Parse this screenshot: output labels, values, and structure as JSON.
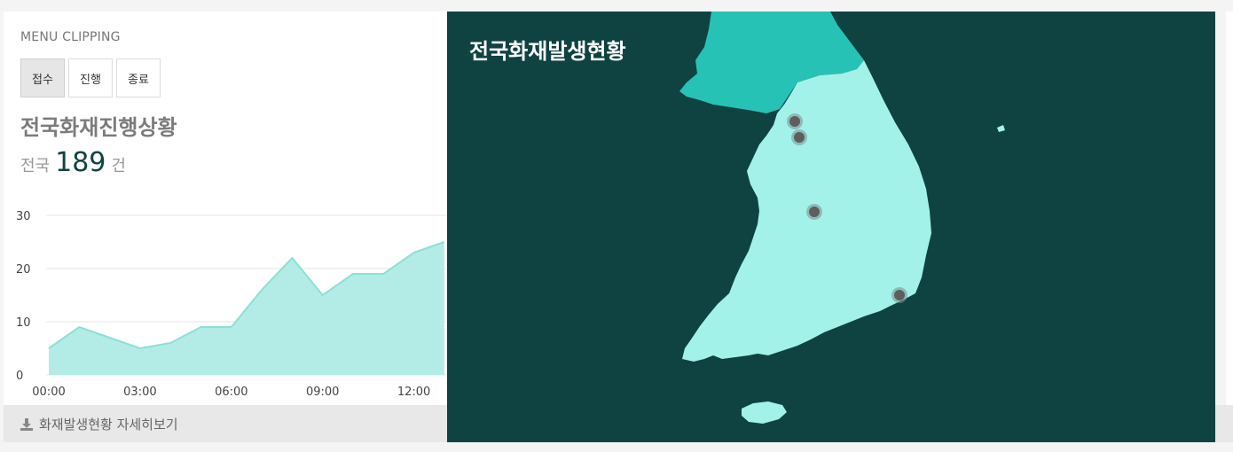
{
  "left_panel": {
    "menu_title": "MENU CLIPPING",
    "tabs": [
      {
        "label": "접수",
        "active": true
      },
      {
        "label": "진행",
        "active": false
      },
      {
        "label": "종료",
        "active": false
      }
    ],
    "status_title": "전국화재진행상황",
    "count": {
      "prefix": "전국",
      "value": "189",
      "suffix": "건"
    }
  },
  "chart_data": {
    "type": "area",
    "x": [
      "00:00",
      "01:00",
      "02:00",
      "03:00",
      "04:00",
      "05:00",
      "06:00",
      "07:00",
      "08:00",
      "09:00",
      "10:00",
      "11:00",
      "12:00",
      "13:00"
    ],
    "series": [
      {
        "values": [
          5,
          9,
          7,
          5,
          6,
          9,
          9,
          16,
          22,
          15,
          19,
          19,
          23,
          25
        ]
      }
    ],
    "x_tick_labels": [
      "00:00",
      "03:00",
      "06:00",
      "09:00",
      "12:00"
    ],
    "y_ticks": [
      0,
      10,
      20,
      30
    ],
    "ylim": [
      0,
      30
    ],
    "grid": true,
    "colors": {
      "fill": "#b3ece6",
      "line": "#8de0d6"
    }
  },
  "footer": {
    "link_label": "화재발생현황 자세히보기",
    "icon": "download-icon"
  },
  "map": {
    "title": "전국화재발생현황",
    "colors": {
      "background": "#0f4341",
      "north": "#26c2b5",
      "south": "#a3f2ea",
      "marker": "#5e5e5e"
    },
    "markers": [
      {
        "name": "marker-1"
      },
      {
        "name": "marker-2"
      },
      {
        "name": "marker-3"
      },
      {
        "name": "marker-4"
      }
    ]
  }
}
